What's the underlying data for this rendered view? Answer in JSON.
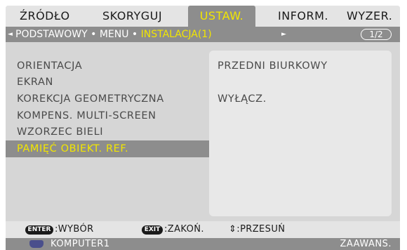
{
  "tabs": [
    "ŹRÓDŁO",
    "SKORYGUJ",
    "USTAW.",
    "INFORM.",
    "WYZER."
  ],
  "active_tab": "USTAW.",
  "breadcrumb": {
    "left_arrow": "◄",
    "path_prefix": "PODSTAWOWY • MENU • ",
    "path_current": "INSTALACJA(1)",
    "right_arrow": "►",
    "page_indicator": "1/2"
  },
  "menu_items": [
    {
      "label": "ORIENTACJA",
      "value": "PRZEDNI BIURKOWY"
    },
    {
      "label": "EKRAN",
      "value": ""
    },
    {
      "label": "KOREKCJA GEOMETRYCZNA",
      "value": "WYŁĄCZ."
    },
    {
      "label": "KOMPENS. MULTI-SCREEN",
      "value": ""
    },
    {
      "label": "WZORZEC BIELI",
      "value": ""
    },
    {
      "label": "PAMIĘĆ OBIEKT. REF.",
      "value": ""
    }
  ],
  "selected_index": 5,
  "help": {
    "enter_key": "ENTER",
    "enter_label": ":WYBÓR",
    "exit_key": "EXIT",
    "exit_label": ":ZAKOŃ.",
    "move_label": "⇕:PRZESUŃ"
  },
  "status": {
    "source": "KOMPUTER1",
    "mode": "ZAAWANS."
  },
  "colors": {
    "highlight_text": "#f2e600",
    "active_tab_bg": "#8d8d8d",
    "menu_bg": "#d6d6d6",
    "source_icon": "#4a4f8c"
  },
  "icons": {
    "source": "monitor-icon"
  }
}
